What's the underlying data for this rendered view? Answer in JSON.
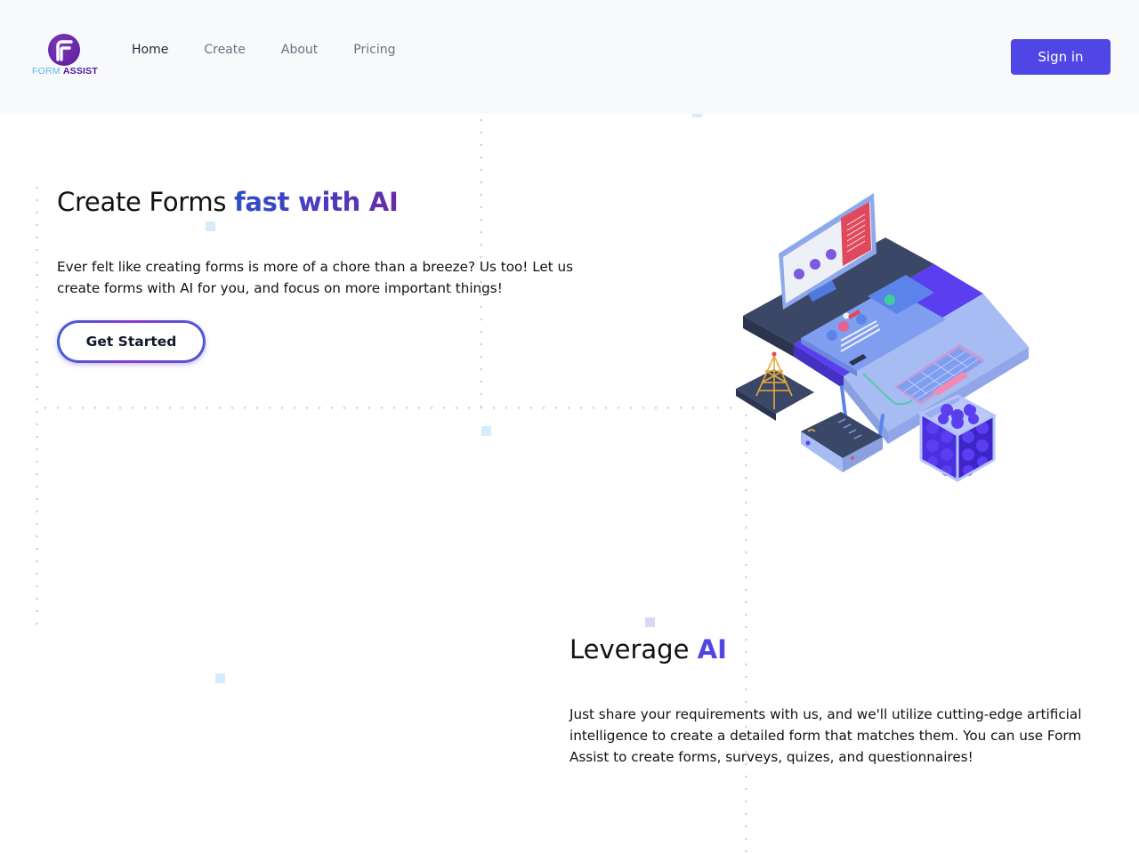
{
  "brand": {
    "name_part1": "FORM",
    "name_part2": "ASSIST",
    "logo_icon": "letter-f-logo-icon"
  },
  "nav": {
    "items": [
      {
        "label": "Home",
        "active": true
      },
      {
        "label": "Create",
        "active": false
      },
      {
        "label": "About",
        "active": false
      },
      {
        "label": "Pricing",
        "active": false
      }
    ],
    "signin_label": "Sign in"
  },
  "hero": {
    "title_plain": "Create Forms ",
    "title_highlight": "fast with AI",
    "description": "Ever felt like creating forms is more of a chore than a breeze? Us too! Let us create forms with AI for you, and focus on more important things!",
    "cta_label": "Get Started",
    "illustration": "isometric-computer-workspace-illustration"
  },
  "feature": {
    "title_plain": "Leverage ",
    "title_highlight": "AI",
    "description": "Just share your requirements with us, and we'll utilize cutting-edge artificial intelligence to create a detailed form that matches them. You can use Form Assist to create forms, surveys, quizes, and questionnaires!"
  },
  "colors": {
    "header_bg": "#f8f9fb",
    "primary": "#4f46e5",
    "gradient_start": "#2b4fc4",
    "gradient_end": "#6a2aa8",
    "logo_purple": "#5b1a9c",
    "logo_cyan": "#5ab8e6"
  }
}
